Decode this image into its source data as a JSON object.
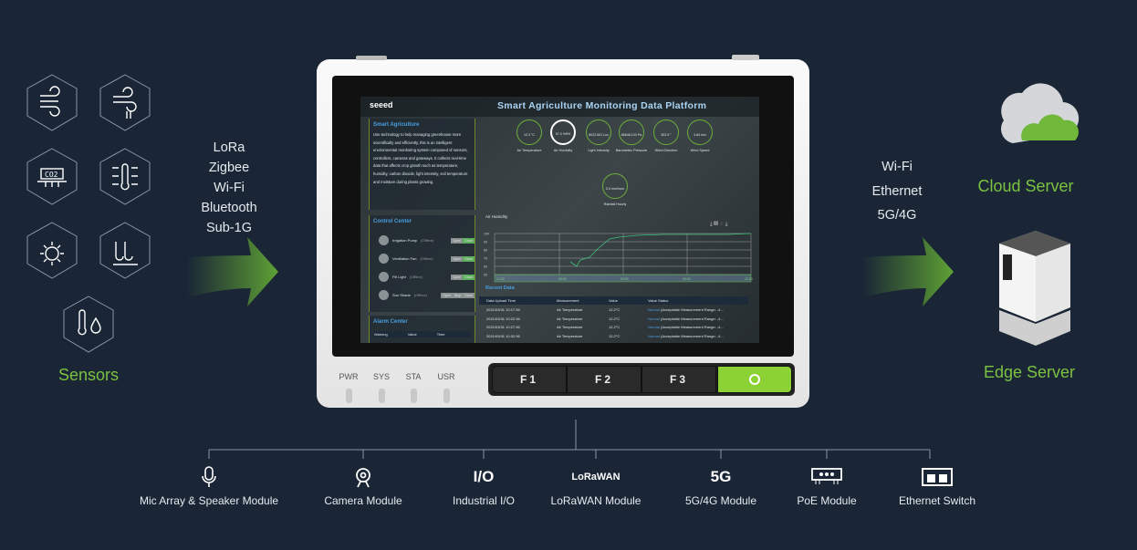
{
  "sensors": {
    "label": "Sensors",
    "icons": [
      "wind-icon",
      "wind-speed-icon",
      "co2-sensor-icon",
      "thermometer-icon",
      "light-icon",
      "soil-moisture-icon",
      "temperature-humidity-icon"
    ]
  },
  "left_protocols": [
    "LoRa",
    "Zigbee",
    "Wi-Fi",
    "Bluetooth",
    "Sub-1G"
  ],
  "right_protocols": [
    "Wi-Fi",
    "Ethernet",
    "5G/4G"
  ],
  "cloud_server": "Cloud Server",
  "edge_server": "Edge Server",
  "device": {
    "leds": [
      "PWR",
      "SYS",
      "STA",
      "USR"
    ],
    "buttons": [
      "F1",
      "F2",
      "F3"
    ],
    "screen": {
      "logo": "seeed",
      "title": "Smart Agriculture Monitoring Data Platform",
      "intro": {
        "heading": "Smart Agriculture",
        "text": "Use technology to help managing greenhouse more scientifically and efficiently, this is an intelligent environmental monitoring system composed of sensors, controllers, cameras and gateways. It collects real-time data that affects crop growth such as temperature, humidity, carbon dioxide, light intensity, soil temperature and moisture during plants growing."
      },
      "gauges": [
        {
          "value": "12.3 °C",
          "label": "Air Temperature"
        },
        {
          "value": "97.0 %RH",
          "label": "Air Humidity"
        },
        {
          "value": "8022.601 Lux",
          "label": "Light Intensity"
        },
        {
          "value": "86848.103 Pa",
          "label": "Barometric Pressure"
        },
        {
          "value": "302.9 °",
          "label": "Wind Direction"
        },
        {
          "value": "3.84 m/s",
          "label": "Wind Speed"
        },
        {
          "value": "0.0 mm/hour",
          "label": "Rainfall Hourly"
        }
      ],
      "control": {
        "heading": "Control Center",
        "items": [
          {
            "name": "Irrigation Pump",
            "state": "(Offline)"
          },
          {
            "name": "Ventilation Fan",
            "state": "(Offline)"
          },
          {
            "name": "Fill Light",
            "state": "(Offline)"
          },
          {
            "name": "Sun Shade",
            "state": "(Offline)"
          }
        ],
        "open": "Open",
        "close": "Close",
        "stop": "Stop"
      },
      "alarm": {
        "heading": "Alarm Center",
        "columns": [
          "Warning",
          "Value",
          "Time"
        ]
      },
      "chart": {
        "title": "Air Humidity",
        "y_ticks": [
          "100",
          "90",
          "80",
          "70",
          "60",
          "50"
        ],
        "x_ticks": [
          "12:00",
          "06:00",
          "00:00",
          "06:00",
          "12:00"
        ]
      },
      "recent": {
        "heading": "Recent Data",
        "columns": [
          "Data Upload Time",
          "Measurement",
          "Value",
          "Value Status"
        ],
        "rows": [
          [
            "2021/03/31 10:17:36",
            "Air Temperature",
            "12.2°C",
            "Normal",
            "(Acceptable Measurement Range: -4..."
          ],
          [
            "2021/03/31 10:22:36",
            "Air Temperature",
            "12.2°C",
            "Normal",
            "(Acceptable Measurement Range: -4..."
          ],
          [
            "2021/03/31 10:27:36",
            "Air Temperature",
            "12.2°C",
            "Normal",
            "(Acceptable Measurement Range: -4..."
          ],
          [
            "2021/03/31 10:32:36",
            "Air Temperature",
            "12.2°C",
            "Normal",
            "(Acceptable Measurement Range: -4..."
          ]
        ]
      }
    }
  },
  "modules": [
    {
      "label": "Mic Array & Speaker Module",
      "icon": "microphone-icon"
    },
    {
      "label": "Camera Module",
      "icon": "camera-icon"
    },
    {
      "label": "Industrial I/O",
      "icon": "io-icon",
      "glyph": "I/O"
    },
    {
      "label": "LoRaWAN Module",
      "icon": "lorawan-icon",
      "glyph": "LoRaWAN"
    },
    {
      "label": "5G/4G Module",
      "icon": "5g-icon",
      "glyph": "5G"
    },
    {
      "label": "PoE Module",
      "icon": "poe-icon"
    },
    {
      "label": "Ethernet Switch",
      "icon": "ethernet-switch-icon"
    }
  ],
  "colors": {
    "background": "#1a2636",
    "accent": "#7cc241"
  }
}
